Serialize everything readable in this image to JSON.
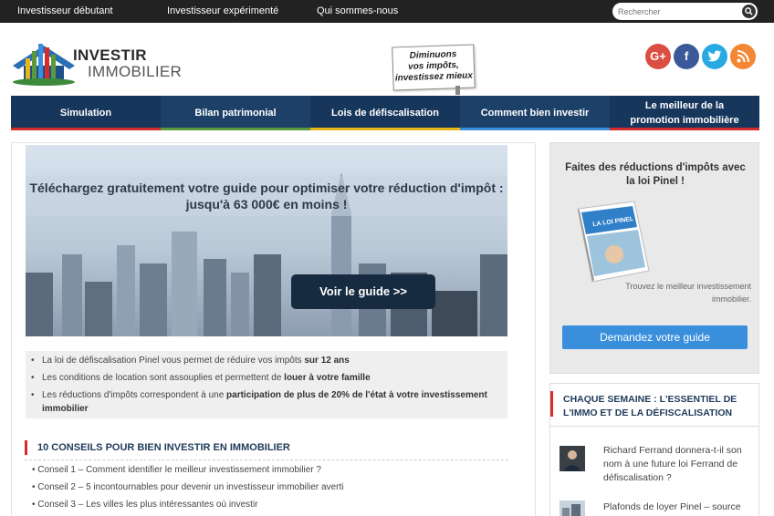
{
  "topnav": {
    "links": [
      "Investisseur débutant",
      "Investisseur expérimenté",
      "Qui sommes-nous"
    ],
    "search_placeholder": "Rechercher"
  },
  "header": {
    "logo_line1": "INVESTIR",
    "logo_line2": "IMMOBILIER",
    "sign_line1": "Diminuons",
    "sign_line2": "vos impôts,",
    "sign_line3": "investissez mieux",
    "social": [
      "G+",
      "f",
      "twitter",
      "rss"
    ]
  },
  "nav": {
    "items": [
      {
        "label": "Simulation",
        "accent": "#d62b2b"
      },
      {
        "label": "Bilan patrimonial",
        "accent": "#5a9a3c"
      },
      {
        "label": "Lois de défiscalisation",
        "accent": "#e8b619"
      },
      {
        "label": "Comment bien investir",
        "accent": "#3a8fdc"
      },
      {
        "label": "Le meilleur de la promotion immobilière",
        "accent": "#d62b2b"
      }
    ]
  },
  "banner": {
    "text": "Téléchargez gratuitement votre guide pour optimiser votre réduction d'impôt : jusqu'à 63 000€ en moins !",
    "button": "Voir le guide >>"
  },
  "bullets": [
    {
      "pre": "La loi de défiscalisation Pinel vous permet de réduire vos impôts ",
      "bold": "sur 12 ans"
    },
    {
      "pre": "Les conditions de location sont assouplies et permettent de ",
      "bold": "louer à votre famille"
    },
    {
      "pre": "Les réductions d'impôts correspondent à une ",
      "bold": "participation de plus de 20% de l'état à votre investissement immobilier"
    }
  ],
  "conseils": {
    "title": "10 CONSEILS POUR BIEN INVESTIR EN IMMOBILIER",
    "items": [
      "Conseil 1 – Comment identifier le meilleur investissement immobilier ?",
      "Conseil 2 – 5 incontournables pour devenir un investisseur immobilier averti",
      "Conseil 3 – Les villes les plus intéressantes où investir"
    ]
  },
  "sidebar": {
    "promo_title": "Faites des réductions d'impôts avec la loi Pinel !",
    "book_cover_text": "LA LOI PINEL",
    "promo_caption": "Trouvez le meilleur investissement immobilier.",
    "promo_button": "Demandez votre guide",
    "weekly_title": "CHAQUE SEMAINE : L'ESSENTIEL DE L'IMMO ET DE LA DÉFISCALISATION",
    "news": [
      "Richard Ferrand donnera-t-il son nom à une future loi Ferrand de défiscalisation ?",
      "Plafonds de loyer Pinel – source"
    ]
  }
}
